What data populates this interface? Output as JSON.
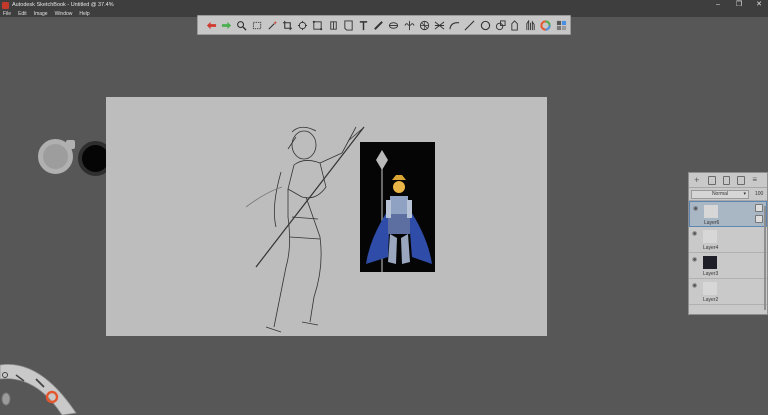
{
  "window": {
    "title": "Autodesk SketchBook - Untitled @ 37.4%",
    "controls": [
      "–",
      "❐",
      "✕"
    ]
  },
  "menu": [
    "File",
    "Edit",
    "Image",
    "Window",
    "Help"
  ],
  "toolbar": {
    "tools": [
      "undo-icon",
      "redo-icon",
      "zoom-icon",
      "select-icon",
      "magic-wand-icon",
      "crop-icon",
      "transform-icon",
      "distort-icon",
      "ruler-icon",
      "shape-icon",
      "text-icon",
      "stroke-ruler-icon",
      "ellipse-icon",
      "symmetry-icon",
      "perspective-icon",
      "distort-grid-icon",
      "curve-icon",
      "line-icon",
      "circle-icon",
      "copic-icon",
      "pen-icon",
      "brush-icon",
      "color-wheel-icon",
      "palette-icon"
    ],
    "colors": {
      "undo": "#d13a2f",
      "redo": "#4caf50",
      "accent": "#4a90e2"
    }
  },
  "canvas": {
    "reference_image": "armored warrior with halberd"
  },
  "layers": {
    "blend_mode": "Normal",
    "opacity": "100",
    "items": [
      {
        "name": "Layer6",
        "selected": true
      },
      {
        "name": "Layer4",
        "selected": false
      },
      {
        "name": "Layer3",
        "selected": false
      },
      {
        "name": "Layer2",
        "selected": false
      }
    ]
  }
}
